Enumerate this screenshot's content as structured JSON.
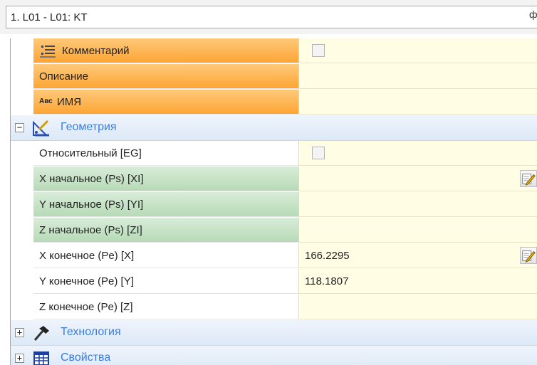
{
  "header": {
    "combo_value": "1. L01 - L01: KT",
    "combo_arrow": "ф"
  },
  "properties": [
    {
      "label": "Комментарий",
      "style": "orange",
      "icon": "comment-lines-icon",
      "value": "",
      "control": "checkbox"
    },
    {
      "label": "Описание",
      "style": "orange",
      "value": ""
    },
    {
      "label": "ИМЯ",
      "prefix": "Авс",
      "style": "orange",
      "value": ""
    }
  ],
  "categories": {
    "geometry": {
      "label": "Геометрия",
      "expander": "−",
      "icon": "geometry-ruler-icon"
    },
    "technology": {
      "label": "Технология",
      "expander": "+",
      "icon": "hammer-icon"
    },
    "properties": {
      "label": "Свойства",
      "expander": "+",
      "icon": "table-grid-icon"
    }
  },
  "geometry_rows": [
    {
      "label": "Относительный [EG]",
      "style": "plain",
      "value": "",
      "control": "checkbox"
    },
    {
      "label": "X начальное (Ps) [XI]",
      "style": "green",
      "value": "",
      "control": "edit"
    },
    {
      "label": "Y начальное (Ps) [YI]",
      "style": "green",
      "value": ""
    },
    {
      "label": "Z начальное (Ps) [ZI]",
      "style": "green",
      "value": ""
    },
    {
      "label": "X конечное (Pe) [X]",
      "style": "plain",
      "value": "166.2295",
      "control": "edit"
    },
    {
      "label": "Y конечное (Pe) [Y]",
      "style": "plain",
      "value": "118.1807"
    },
    {
      "label": "Z конечное (Pe) [Z]",
      "style": "plain",
      "value": ""
    }
  ],
  "colors": {
    "orange_band": "#fda534",
    "green_band": "#b7dab7",
    "value_bg": "#fffde3",
    "category_text": "#3a7de0"
  }
}
